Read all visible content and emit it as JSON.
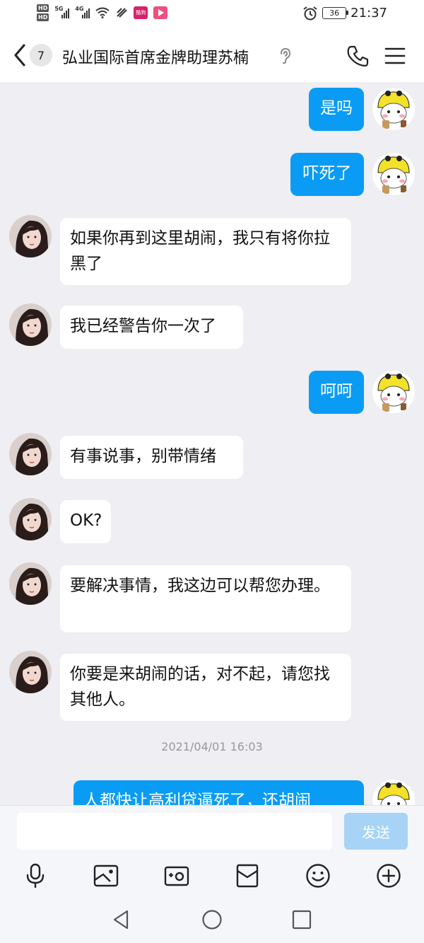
{
  "status_bar": {
    "hd1": "HD",
    "hd2": "HD",
    "network1": "5G",
    "network2": "4G",
    "app_badge_text": "酷狗",
    "battery": "36",
    "time": "21:37"
  },
  "header": {
    "unread_count": "7",
    "title": "弘业国际首席金牌助理苏楠"
  },
  "messages": [
    {
      "side": "out",
      "text": "是吗"
    },
    {
      "side": "out",
      "text": "吓死了"
    },
    {
      "side": "in",
      "text": "如果你再到这里胡闹，我只有将你拉黑了"
    },
    {
      "side": "in",
      "text": "我已经警告你一次了"
    },
    {
      "side": "out",
      "text": "呵呵"
    },
    {
      "side": "in",
      "text": "有事说事，别带情绪"
    },
    {
      "side": "in",
      "text": "OK?"
    },
    {
      "side": "in",
      "text": "要解决事情，我这边可以帮您办理。"
    },
    {
      "side": "in",
      "text": "你要是来胡闹的话，对不起，请您找其他人。"
    },
    {
      "side": "out",
      "text": "人都快让高利贷逼死了，还胡闹"
    }
  ],
  "timestamp": "2021/04/01 16:03",
  "input": {
    "value": "",
    "placeholder": "",
    "send_label": "发送"
  },
  "colors": {
    "outgoing_bubble": "#0a9cf5",
    "incoming_bubble": "#ffffff",
    "chat_background": "#eeeef3",
    "send_button": "#a7d4f6"
  },
  "icons": {
    "back": "chevron-left-icon",
    "ear": "ear-icon",
    "phone": "phone-icon",
    "menu": "menu-icon",
    "toolbar": [
      "microphone-icon",
      "image-icon",
      "camera-icon",
      "red-packet-icon",
      "emoji-icon",
      "plus-icon"
    ],
    "nav": [
      "back-triangle-icon",
      "home-circle-icon",
      "recents-square-icon"
    ]
  }
}
